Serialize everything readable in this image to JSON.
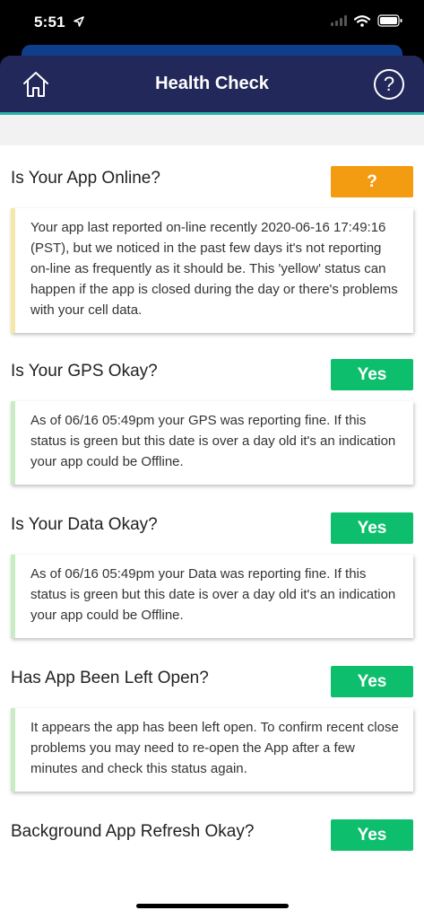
{
  "status_bar": {
    "time": "5:51"
  },
  "header": {
    "title": "Health Check",
    "help_label": "?"
  },
  "checks": [
    {
      "question": "Is Your App Online?",
      "status": "?",
      "status_color": "#f39c12",
      "message": "Your app last reported on-line recently 2020-06-16 17:49:16 (PST), but we noticed in the past few days it's not reporting on-line as frequently as it should be. This 'yellow' status can happen if the app is closed during the day or there's problems with your cell data."
    },
    {
      "question": "Is Your GPS Okay?",
      "status": "Yes",
      "status_color": "#0dbf6c",
      "message": "As of 06/16 05:49pm your GPS was reporting fine. If this status is green but this date is over a day old it's an indication your app could be Offline."
    },
    {
      "question": "Is Your Data Okay?",
      "status": "Yes",
      "status_color": "#0dbf6c",
      "message": "As of 06/16 05:49pm your Data was reporting fine. If this status is green but this date is over a day old it's an indication your app could be Offline."
    },
    {
      "question": "Has App Been Left Open?",
      "status": "Yes",
      "status_color": "#0dbf6c",
      "message": "It appears the app has been left open. To confirm recent close problems you may need to re-open the App after a few minutes and check this status again."
    },
    {
      "question": "Background App Refresh Okay?",
      "status": "Yes",
      "status_color": "#0dbf6c"
    }
  ]
}
